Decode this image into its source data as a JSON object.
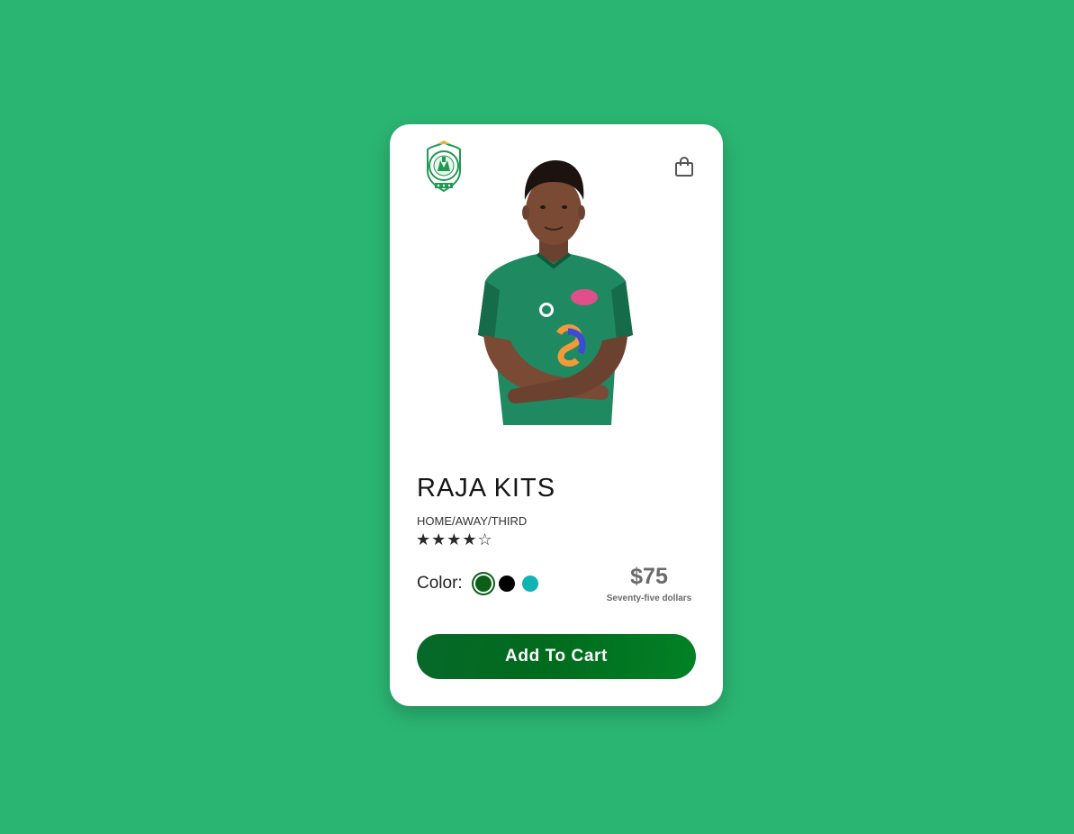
{
  "product": {
    "title": "RAJA KITS",
    "subtitle": "HOME/AWAY/THIRD",
    "rating": {
      "value": 4,
      "max": 5,
      "display": "★★★★☆"
    },
    "color_label": "Color:",
    "colors": [
      {
        "name": "dark-green",
        "hex": "#0b5f16",
        "selected": true
      },
      {
        "name": "black",
        "hex": "#000000",
        "selected": false
      },
      {
        "name": "teal",
        "hex": "#11b2b2",
        "selected": false
      }
    ],
    "price": "$75",
    "price_words": "Seventy-five dollars",
    "add_to_cart_label": "Add To Cart"
  },
  "icons": {
    "logo": "raja-club-crest-icon",
    "cart": "shopping-bag-icon"
  },
  "theme": {
    "background": "#2bb573",
    "card": "#ffffff",
    "button_gradient": [
      "#07692a",
      "#028226"
    ]
  }
}
